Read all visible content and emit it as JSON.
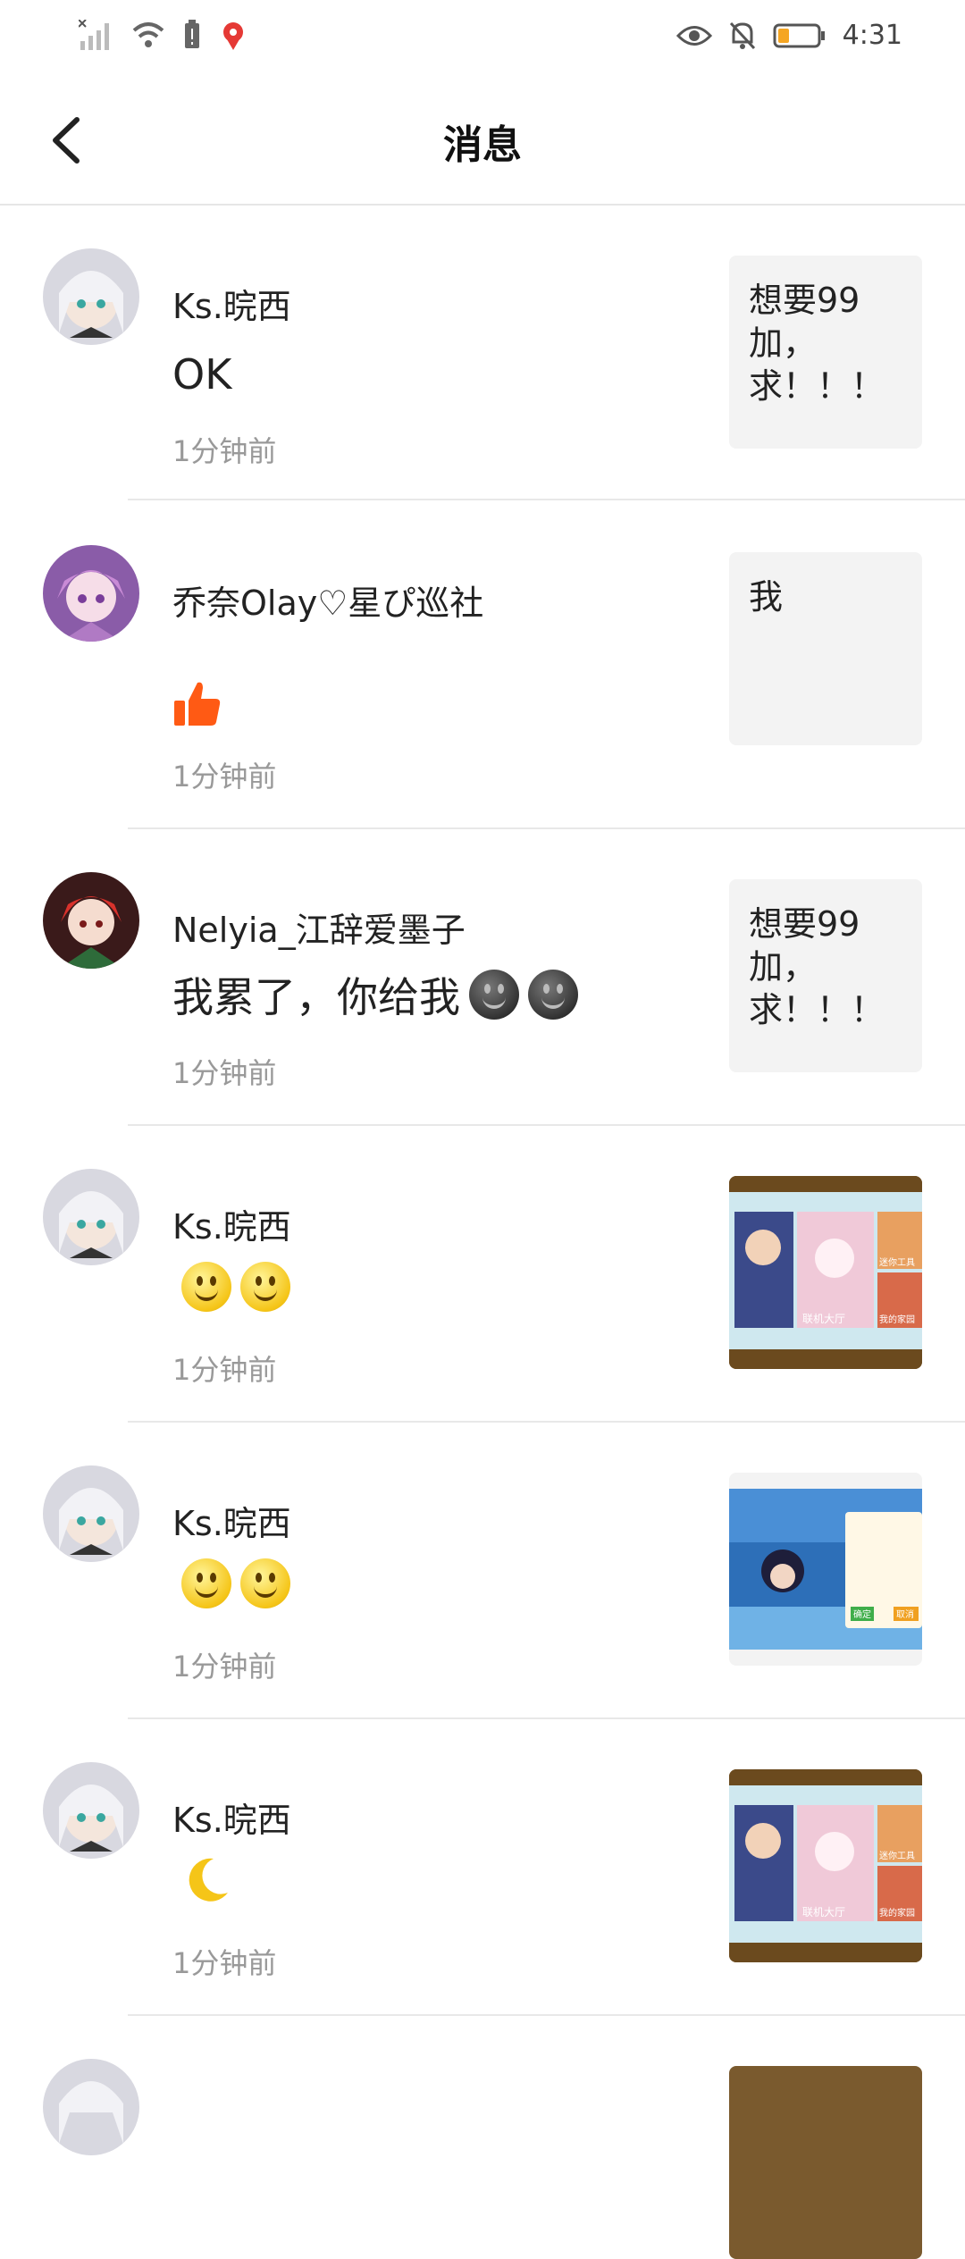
{
  "status_bar": {
    "time": "4:31"
  },
  "header": {
    "title": "消息"
  },
  "messages": [
    {
      "name": "Ks.晥西",
      "text": "OK",
      "time": "1分钟前",
      "thumb_text": "想要99\n加，\n求！！！"
    },
    {
      "name": "乔奈Olay♡星ぴ巡社",
      "text": "",
      "time": "1分钟前",
      "thumb_text": "我"
    },
    {
      "name": "Nelyia_江辞爱墨子",
      "text": "我累了，你给我",
      "time": "1分钟前",
      "thumb_text": "想要99\n加，\n求！！！"
    },
    {
      "name": "Ks.晥西",
      "text": "",
      "time": "1分钟前",
      "thumb_labels": [
        "联机大厅",
        "迷你工具",
        "我的家园"
      ]
    },
    {
      "name": "Ks.晥西",
      "text": "",
      "time": "1分钟前",
      "thumb_labels": [
        "确定",
        "取消"
      ]
    },
    {
      "name": "Ks.晥西",
      "text": "",
      "time": "1分钟前",
      "thumb_labels": [
        "联机大厅",
        "迷你工具",
        "我的家园"
      ]
    }
  ],
  "colors": {
    "accent": "#ff5a14",
    "divider": "#e8e8e8",
    "meta_text": "#999999"
  }
}
